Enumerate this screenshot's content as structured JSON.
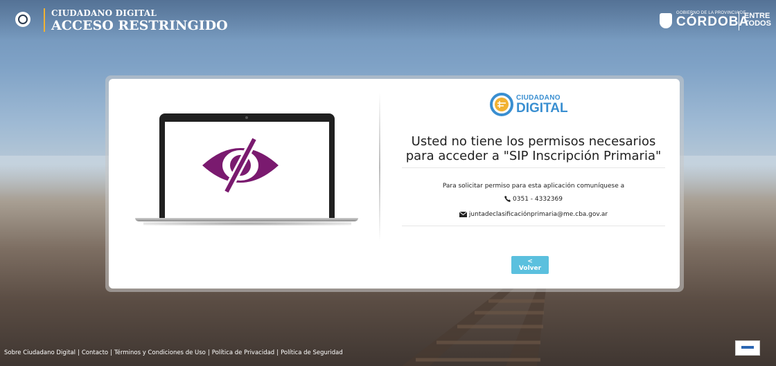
{
  "header": {
    "subtitle": "CIUDADANO DIGITAL",
    "title": "ACCESO RESTRINGIDO",
    "gov_small": "GOBIERNO DE LA PROVINCIA DE",
    "gov_name": "CÓRDOBA",
    "slogan_line1": "ENTRE",
    "slogan_line2": "TODOS"
  },
  "card": {
    "logo_line1": "CIUDADANO",
    "logo_line2": "DIGITAL",
    "message_line1": "Usted no tiene los permisos necesarios",
    "message_line2": "para acceder a \"SIP Inscripción Primaria\"",
    "request_text": "Para solicitar permiso para esta aplicación comuníquese a",
    "phone": "0351 - 4332369",
    "email": "juntadeclasificaciónprimaria@me.cba.gov.ar",
    "back_button": "< Volver"
  },
  "footer": {
    "links": [
      "Sobre Ciudadano Digital",
      "Contacto",
      "Términos y Condiciones de Uso",
      "Política de Privacidad",
      "Política de Seguridad"
    ],
    "separator": "|"
  },
  "colors": {
    "accent_blue": "#3a8fd1",
    "button": "#5bc0de",
    "eye_purple": "#7a1a6f",
    "header_divider": "#f2b233"
  }
}
